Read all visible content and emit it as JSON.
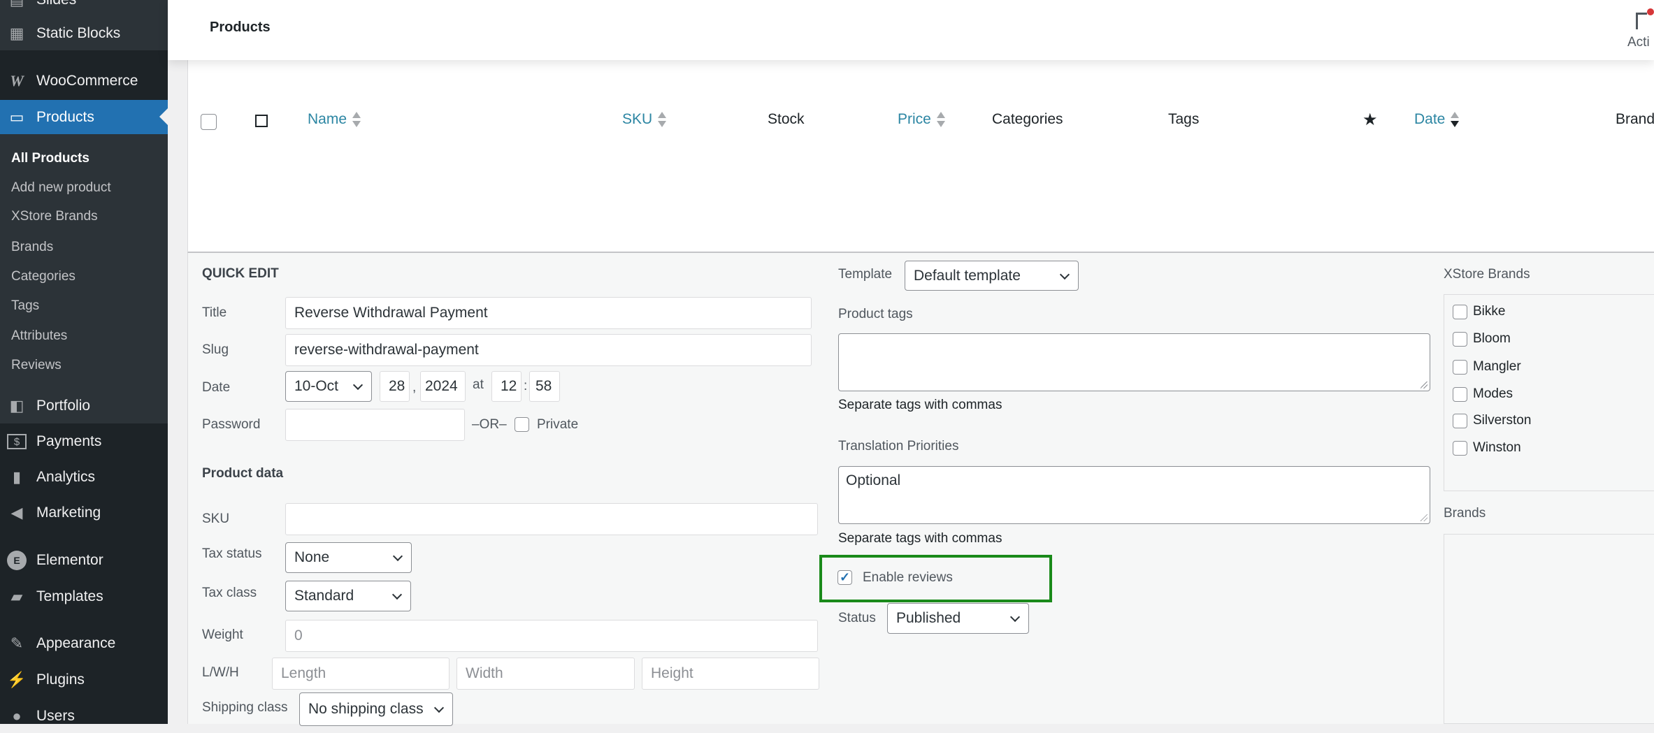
{
  "sidebar": {
    "top_items": [
      {
        "label": "Slides",
        "icon": "slides-icon"
      },
      {
        "label": "Static Blocks",
        "icon": "static-blocks-icon"
      }
    ],
    "woocommerce": {
      "label": "WooCommerce",
      "icon": "woocommerce-icon"
    },
    "products": {
      "label": "Products",
      "icon": "archive-icon"
    },
    "submenu": [
      "All Products",
      "Add new product",
      "XStore Brands",
      "Brands",
      "Categories",
      "Tags",
      "Attributes",
      "Reviews"
    ],
    "items": [
      {
        "label": "Portfolio",
        "icon": "portfolio-icon"
      },
      {
        "label": "Payments",
        "icon": "dollar-icon"
      },
      {
        "label": "Analytics",
        "icon": "bar-chart-icon"
      },
      {
        "label": "Marketing",
        "icon": "megaphone-icon"
      },
      {
        "label": "Elementor",
        "icon": "elementor-icon"
      },
      {
        "label": "Templates",
        "icon": "folder-icon"
      },
      {
        "label": "Appearance",
        "icon": "paintbrush-icon"
      },
      {
        "label": "Plugins",
        "icon": "plug-icon"
      },
      {
        "label": "Users",
        "icon": "user-icon"
      }
    ],
    "active_color": "#2271b1"
  },
  "header": {
    "title": "Products",
    "activity_label": "Acti"
  },
  "table": {
    "columns": [
      "Name",
      "SKU",
      "Stock",
      "Price",
      "Categories",
      "Tags",
      "Date",
      "Brand"
    ]
  },
  "quick_edit": {
    "heading": "QUICK EDIT",
    "title_label": "Title",
    "title_value": "Reverse Withdrawal Payment",
    "slug_label": "Slug",
    "slug_value": "reverse-withdrawal-payment",
    "date_label": "Date",
    "month": "10-Oct",
    "day": "28",
    "comma": ",",
    "year": "2024",
    "at": "at",
    "hour": "12",
    "colon": ":",
    "minute": "58",
    "password_label": "Password",
    "or_label": "–OR–",
    "private_label": "Private",
    "product_data_heading": "Product data",
    "sku_label": "SKU",
    "tax_status_label": "Tax status",
    "tax_status_value": "None",
    "tax_class_label": "Tax class",
    "tax_class_value": "Standard",
    "weight_label": "Weight",
    "weight_value": "0",
    "lwh_label": "L/W/H",
    "length_placeholder": "Length",
    "width_placeholder": "Width",
    "height_placeholder": "Height",
    "shipping_class_label": "Shipping class",
    "shipping_class_value": "No shipping class",
    "template_label": "Template",
    "template_value": "Default template",
    "product_tags_label": "Product tags",
    "tags_help": "Separate tags with commas",
    "translation_label": "Translation Priorities",
    "translation_value": "Optional",
    "translation_help": "Separate tags with commas",
    "enable_reviews_label": "Enable reviews",
    "enable_reviews_checked": true,
    "highlight_color": "#1a8a1a",
    "status_label": "Status",
    "status_value": "Published",
    "xstore_brands_label": "XStore Brands",
    "xstore_brands": [
      "Bikke",
      "Bloom",
      "Mangler",
      "Modes",
      "Silverston",
      "Winston"
    ],
    "brands_label": "Brands"
  }
}
